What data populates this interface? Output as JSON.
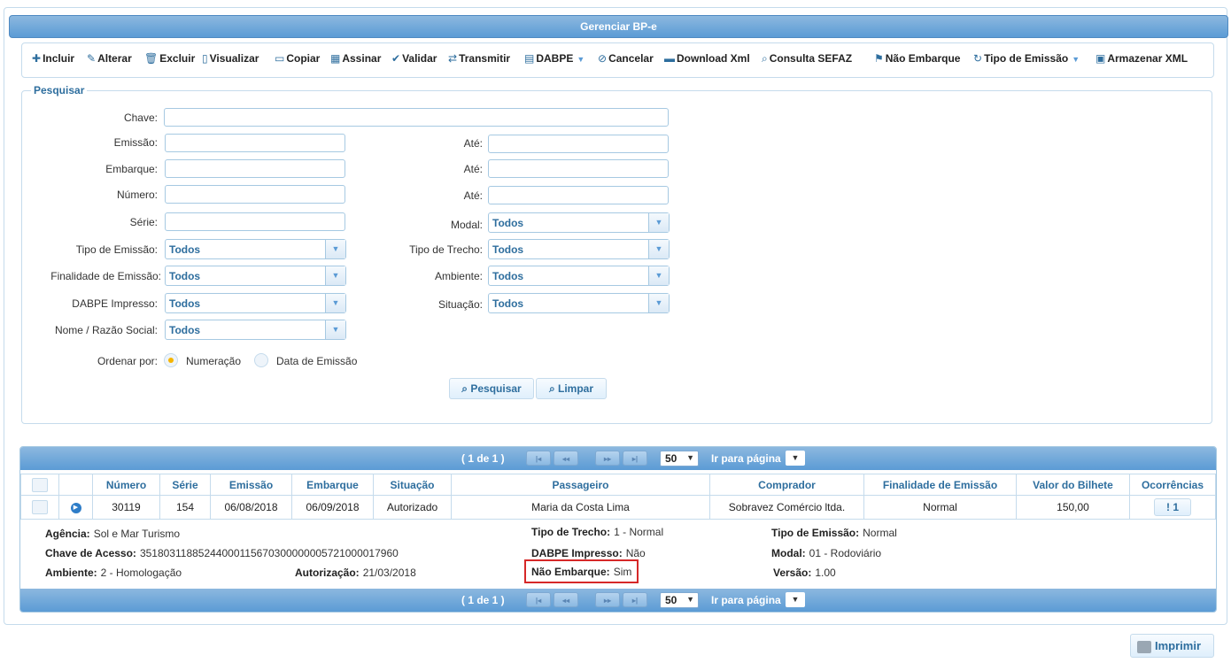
{
  "window": {
    "title": "Gerenciar BP-e"
  },
  "toolbar": {
    "incluir": "Incluir",
    "alterar": "Alterar",
    "excluir": "Excluir",
    "visualizar": "Visualizar",
    "copiar": "Copiar",
    "assinar": "Assinar",
    "validar": "Validar",
    "transmitir": "Transmitir",
    "dabpe": "DABPE",
    "cancelar": "Cancelar",
    "download_xml": "Download Xml",
    "consulta_sefaz": "Consulta SEFAZ",
    "nao_embarque": "Não Embarque",
    "tipo_emissao": "Tipo de Emissão",
    "armazenar_xml": "Armazenar XML"
  },
  "search": {
    "legend": "Pesquisar",
    "chave_label": "Chave:",
    "emissao_label": "Emissão:",
    "embarque_label": "Embarque:",
    "numero_label": "Número:",
    "serie_label": "Série:",
    "ate_label": "Até:",
    "modal_label": "Modal:",
    "modal_value": "Todos",
    "tipo_emissao_label": "Tipo de Emissão:",
    "tipo_emissao_value": "Todos",
    "tipo_trecho_label": "Tipo de Trecho:",
    "tipo_trecho_value": "Todos",
    "finalidade_label": "Finalidade de Emissão:",
    "finalidade_value": "Todos",
    "ambiente_label": "Ambiente:",
    "ambiente_value": "Todos",
    "dabpe_label": "DABPE Impresso:",
    "dabpe_value": "Todos",
    "situacao_label": "Situação:",
    "situacao_value": "Todos",
    "nome_label": "Nome / Razão Social:",
    "nome_value": "Todos",
    "ordenar_label": "Ordenar por:",
    "opt_numeracao": "Numeração",
    "opt_data": "Data de Emissão",
    "pesquisar_btn": "Pesquisar",
    "limpar_btn": "Limpar"
  },
  "pager": {
    "count": "( 1 de 1 )",
    "page_size": "50",
    "goto_label": "Ir para página"
  },
  "table": {
    "headers": [
      "Número",
      "Série",
      "Emissão",
      "Embarque",
      "Situação",
      "Passageiro",
      "Comprador",
      "Finalidade de Emissão",
      "Valor do Bilhete",
      "Ocorrências"
    ],
    "row": {
      "numero": "30119",
      "serie": "154",
      "emissao": "06/08/2018",
      "embarque": "06/09/2018",
      "situacao": "Autorizado",
      "passageiro": "Maria da Costa Lima",
      "comprador": "Sobravez Comércio ltda.",
      "finalidade": "Normal",
      "valor": "150,00",
      "ocorrencias": "1"
    }
  },
  "details": {
    "agencia_label": "Agência:",
    "agencia": "Sol e Mar Turismo",
    "chave_label": "Chave de Acesso:",
    "chave": "35180311885244000115670300000005721000017960",
    "ambiente_label": "Ambiente:",
    "ambiente": "2 - Homologação",
    "autorizacao_label": "Autorização:",
    "autorizacao": "21/03/2018",
    "tipo_trecho_label": "Tipo de Trecho:",
    "tipo_trecho": "1 - Normal",
    "dabpe_label": "DABPE Impresso:",
    "dabpe": "Não",
    "nao_embarque_label": "Não Embarque:",
    "nao_embarque": "Sim",
    "tipo_emissao_label": "Tipo de Emissão:",
    "tipo_emissao": "Normal",
    "modal_label": "Modal:",
    "modal": "01 - Rodoviário",
    "versao_label": "Versão:",
    "versao": "1.00"
  },
  "footer": {
    "imprimir": "Imprimir"
  },
  "colors": {
    "accent": "#5b9bd5",
    "border": "#c5dbec",
    "highlight": "#d62828"
  }
}
